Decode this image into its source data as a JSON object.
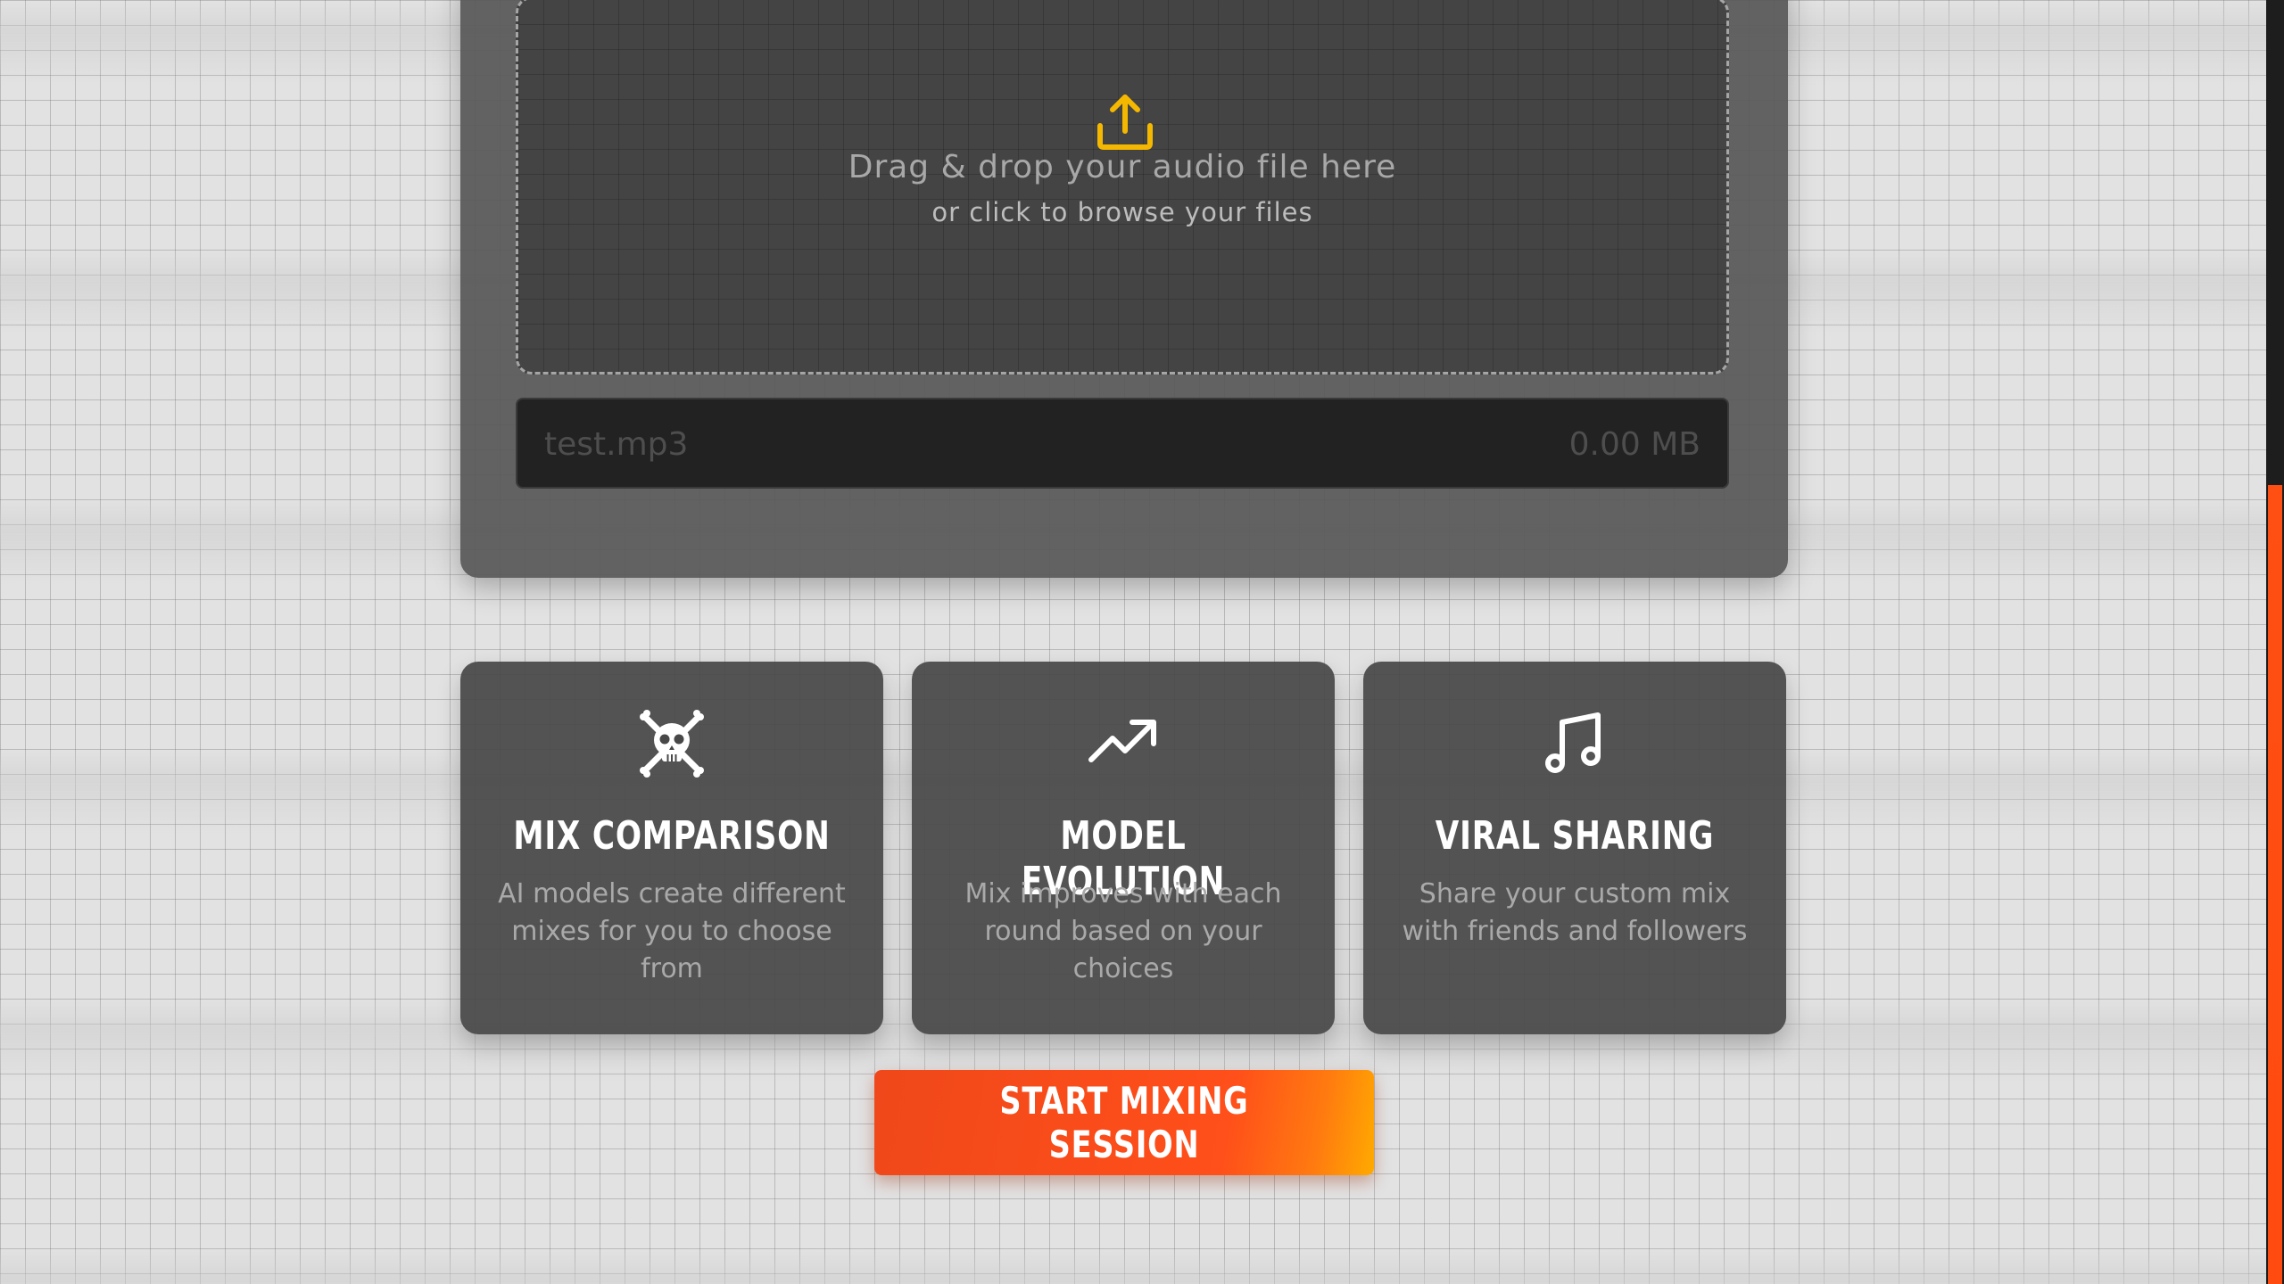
{
  "upload": {
    "title": "Drag & drop your audio file here",
    "subtitle": "or click to browse your files",
    "icon": "upload-icon",
    "accent_color": "#f5b800"
  },
  "file": {
    "name": "test.mp3",
    "size": "0.00 MB"
  },
  "features": [
    {
      "icon": "skull-crossbones-icon",
      "title": "MIX COMPARISON",
      "description": "AI models create different mixes for you to choose from"
    },
    {
      "icon": "trending-up-icon",
      "title": "MODEL EVOLUTION",
      "description": "Mix improves with each round based on your choices"
    },
    {
      "icon": "music-notes-icon",
      "title": "VIRAL SHARING",
      "description": "Share your custom mix with friends and followers"
    }
  ],
  "cta": {
    "label": "START MIXING SESSION",
    "color": "#ff4f1a"
  },
  "scrollbar": {
    "thumb_color": "#ff4f12"
  }
}
